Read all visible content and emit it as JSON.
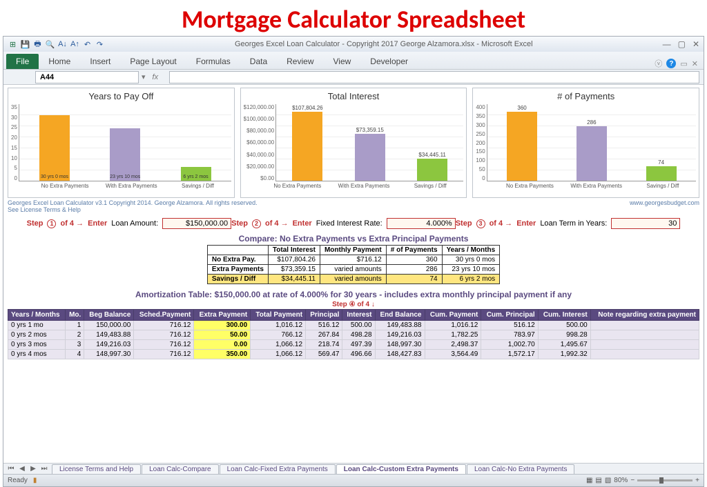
{
  "page_heading": "Mortgage Calculator Spreadsheet",
  "window_title": "Georges Excel Loan Calculator -  Copyright 2017 George Alzamora.xlsx  -  Microsoft Excel",
  "ribbon_tabs": [
    "File",
    "Home",
    "Insert",
    "Page Layout",
    "Formulas",
    "Data",
    "Review",
    "View",
    "Developer"
  ],
  "namebox_value": "A44",
  "copyright_left": "Georges Excel Loan Calculator v3.1   Copyright 2014. George Alzamora. All rights reserved.",
  "license_link": "See License Terms & Help",
  "site_url": "www.georgesbudget.com",
  "chart_data": [
    {
      "type": "bar",
      "title": "Years to Pay Off",
      "categories": [
        "No Extra Payments",
        "With Extra Payments",
        "Savings / Diff"
      ],
      "values": [
        30,
        23.83,
        6.17
      ],
      "bar_labels": [
        "30 yrs 0 mos",
        "23 yrs 10 mos",
        "6 yrs 2 mos"
      ],
      "label_pos": "inside",
      "ylim": [
        0,
        35
      ],
      "yticks": [
        "35",
        "30",
        "25",
        "20",
        "15",
        "10",
        "5",
        "0"
      ]
    },
    {
      "type": "bar",
      "title": "Total Interest",
      "categories": [
        "No Extra Payments",
        "With Extra Payments",
        "Savings / Diff"
      ],
      "values": [
        107804.26,
        73359.15,
        34445.11
      ],
      "bar_labels": [
        "$107,804.26",
        "$73,359.15",
        "$34,445.11"
      ],
      "label_pos": "top",
      "ylim": [
        0,
        120000
      ],
      "yticks": [
        "$120,000.00",
        "$100,000.00",
        "$80,000.00",
        "$60,000.00",
        "$40,000.00",
        "$20,000.00",
        "$0.00"
      ]
    },
    {
      "type": "bar",
      "title": "# of Payments",
      "categories": [
        "No Extra Payments",
        "With Extra Payments",
        "Savings / Diff"
      ],
      "values": [
        360,
        286,
        74
      ],
      "bar_labels": [
        "360",
        "286",
        "74"
      ],
      "label_pos": "top",
      "ylim": [
        0,
        400
      ],
      "yticks": [
        "400",
        "350",
        "300",
        "250",
        "200",
        "150",
        "100",
        "50",
        "0"
      ]
    }
  ],
  "steps": [
    {
      "num": "1",
      "prefix": "Step",
      "mid": "of 4 →",
      "enter": "Enter",
      "label": "Loan Amount:",
      "value": "$150,000.00"
    },
    {
      "num": "2",
      "prefix": "Step",
      "mid": "of 4 →",
      "enter": "Enter",
      "label": "Fixed Interest Rate:",
      "value": "4.000%"
    },
    {
      "num": "3",
      "prefix": "Step",
      "mid": "of 4 →",
      "enter": "Enter",
      "label": "Loan Term in Years:",
      "value": "30"
    }
  ],
  "compare_title": "Compare: No Extra Payments vs Extra Principal Payments",
  "compare_headers": [
    "",
    "Total Interest",
    "Monthly Payment",
    "# of Payments",
    "Years / Months"
  ],
  "compare_rows": [
    {
      "label": "No Extra Pay.",
      "cells": [
        "$107,804.26",
        "$716.12",
        "360",
        "30 yrs 0 mos"
      ]
    },
    {
      "label": "Extra Payments",
      "cells": [
        "$73,359.15",
        "varied amounts",
        "286",
        "23 yrs 10 mos"
      ]
    },
    {
      "label": "Savings / Diff",
      "cells": [
        "$34,445.11",
        "varied amounts",
        "74",
        "6 yrs 2 mos"
      ],
      "highlight": true
    }
  ],
  "amort_title": "Amortization Table:  $150,000.00 at rate of 4.000% for 30 years - includes extra monthly principal payment if any",
  "step4_text": "Step ④ of 4 ↓",
  "amort_headers": [
    "Years / Months",
    "Mo.",
    "Beg Balance",
    "Sched.Payment",
    "Extra Payment",
    "Total Payment",
    "Principal",
    "Interest",
    "End Balance",
    "Cum. Payment",
    "Cum. Principal",
    "Cum. Interest",
    "Note regarding extra payment"
  ],
  "amort_rows": [
    [
      "0 yrs 1 mo",
      "1",
      "150,000.00",
      "716.12",
      "300.00",
      "1,016.12",
      "516.12",
      "500.00",
      "149,483.88",
      "1,016.12",
      "516.12",
      "500.00",
      ""
    ],
    [
      "0 yrs 2 mos",
      "2",
      "149,483.88",
      "716.12",
      "50.00",
      "766.12",
      "267.84",
      "498.28",
      "149,216.03",
      "1,782.25",
      "783.97",
      "998.28",
      ""
    ],
    [
      "0 yrs 3 mos",
      "3",
      "149,216.03",
      "716.12",
      "0.00",
      "1,066.12",
      "218.74",
      "497.39",
      "148,997.30",
      "2,498.37",
      "1,002.70",
      "1,495.67",
      ""
    ],
    [
      "0 yrs 4 mos",
      "4",
      "148,997.30",
      "716.12",
      "350.00",
      "1,066.12",
      "569.47",
      "496.66",
      "148,427.83",
      "3,564.49",
      "1,572.17",
      "1,992.32",
      ""
    ]
  ],
  "sheet_tabs": [
    "License Terms and Help",
    "Loan Calc-Compare",
    "Loan Calc-Fixed Extra Payments",
    "Loan Calc-Custom Extra Payments",
    "Loan Calc-No Extra Payments"
  ],
  "active_sheet": 3,
  "status_text": "Ready",
  "zoom_pct": "80%"
}
